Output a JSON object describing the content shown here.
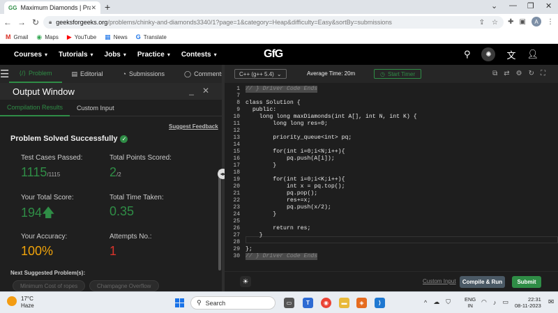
{
  "browser": {
    "tab_title": "Maximum Diamonds | Practice |",
    "tab_favicon": "GG",
    "new_tab": "+",
    "url_host": "geeksforgeeks.org",
    "url_path": "/problems/chinky-and-diamonds3340/1?page=1&category=Heap&difficulty=Easy&sortBy=submissions",
    "profile_initial": "A",
    "bookmarks": [
      {
        "label": "Gmail",
        "icon": "gmail-icon",
        "glyph": "M",
        "color": "#d93025"
      },
      {
        "label": "Maps",
        "icon": "maps-icon",
        "glyph": "◉",
        "color": "#34a853"
      },
      {
        "label": "YouTube",
        "icon": "youtube-icon",
        "glyph": "▶",
        "color": "#ff0000"
      },
      {
        "label": "News",
        "icon": "news-icon",
        "glyph": "▦",
        "color": "#1a73e8"
      },
      {
        "label": "Translate",
        "icon": "translate-icon",
        "glyph": "G",
        "color": "#1a73e8"
      }
    ]
  },
  "gfg_nav": {
    "menus": [
      "Courses",
      "Tutorials",
      "Jobs",
      "Practice",
      "Contests"
    ],
    "logo": "GfG"
  },
  "problem_tabs": {
    "problem": "Problem",
    "editorial": "Editorial",
    "submissions": "Submissions",
    "comments": "Comments"
  },
  "output_window": {
    "title": "Output Window",
    "tabs": [
      "Compilation Results",
      "Custom Input"
    ],
    "suggest_feedback": "Suggest Feedback",
    "status": "Problem Solved Successfully",
    "stats": {
      "test_cases_label": "Test Cases Passed:",
      "test_cases_value": "1115",
      "test_cases_total": "/1115",
      "points_label": "Total Points Scored:",
      "points_value": "2",
      "points_total": "/2",
      "score_label": "Your Total Score:",
      "score_value": "194",
      "time_label": "Total Time Taken:",
      "time_value": "0.35",
      "accuracy_label": "Your Accuracy:",
      "accuracy_value": "100%",
      "attempts_label": "Attempts No.:",
      "attempts_value": "1"
    },
    "next_suggested": "Next Suggested Problem(s):",
    "suggested_problems": [
      "Minimum Cost of ropes",
      "Champagne Overflow"
    ]
  },
  "editor": {
    "language": "C++ (g++ 5.4)",
    "avg_time": "Average Time: 20m",
    "start_timer": "Start Timer",
    "lines": [
      {
        "n": "1",
        "code": "// } Driver Code Ends",
        "style": "hl"
      },
      {
        "n": "7",
        "code": ""
      },
      {
        "n": "8",
        "code": "class Solution {"
      },
      {
        "n": "9",
        "code": "  public:"
      },
      {
        "n": "10",
        "code": "    long long maxDiamonds(int A[], int N, int K) {"
      },
      {
        "n": "11",
        "code": "        long long res=0;"
      },
      {
        "n": "12",
        "code": ""
      },
      {
        "n": "13",
        "code": "        priority_queue<int> pq;"
      },
      {
        "n": "14",
        "code": ""
      },
      {
        "n": "15",
        "code": "        for(int i=0;i<N;i++){"
      },
      {
        "n": "16",
        "code": "            pq.push(A[i]);"
      },
      {
        "n": "17",
        "code": "        }"
      },
      {
        "n": "18",
        "code": ""
      },
      {
        "n": "19",
        "code": "        for(int i=0;i<K;i++){"
      },
      {
        "n": "20",
        "code": "            int x = pq.top();"
      },
      {
        "n": "21",
        "code": "            pq.pop();"
      },
      {
        "n": "22",
        "code": "            res+=x;"
      },
      {
        "n": "23",
        "code": "            pq.push(x/2);"
      },
      {
        "n": "24",
        "code": "        }"
      },
      {
        "n": "25",
        "code": ""
      },
      {
        "n": "26",
        "code": "        return res;"
      },
      {
        "n": "27",
        "code": "    }"
      },
      {
        "n": "28",
        "code": ""
      },
      {
        "n": "29",
        "code": "};"
      },
      {
        "n": "30",
        "code": "// } Driver Code Ends",
        "style": "hl"
      }
    ],
    "custom_input": "Custom Input",
    "compile_run": "Compile & Run",
    "submit": "Submit"
  },
  "taskbar": {
    "temp": "17°C",
    "weather": "Haze",
    "search": "Search",
    "lang1": "ENG",
    "lang2": "IN",
    "time": "22:31",
    "date": "08-11-2023"
  },
  "colors": {
    "accent_green": "#2f8d46",
    "accuracy_orange": "#f0a30a",
    "attempts_red": "#d9342b"
  }
}
